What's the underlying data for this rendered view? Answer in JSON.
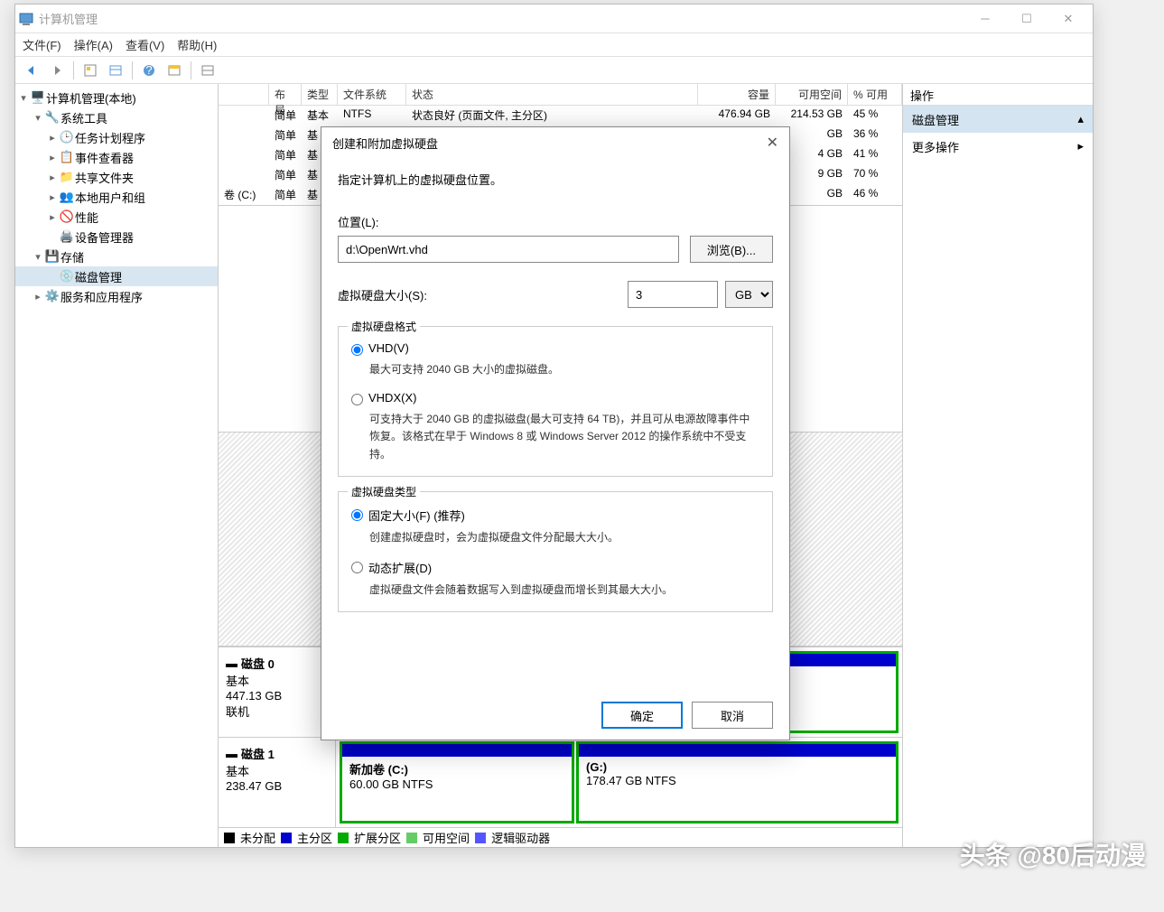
{
  "window": {
    "title": "计算机管理"
  },
  "menu": [
    "文件(F)",
    "操作(A)",
    "查看(V)",
    "帮助(H)"
  ],
  "tree": {
    "root": "计算机管理(本地)",
    "system_tools": "系统工具",
    "items": [
      "任务计划程序",
      "事件查看器",
      "共享文件夹",
      "本地用户和组",
      "性能",
      "设备管理器"
    ],
    "storage": "存储",
    "disk_mgmt": "磁盘管理",
    "services": "服务和应用程序"
  },
  "table": {
    "headers": [
      "",
      "布局",
      "类型",
      "文件系统",
      "状态",
      "容量",
      "可用空间",
      "% 可用"
    ],
    "rows": [
      {
        "vol": "",
        "layout": "简单",
        "type": "基本",
        "fs": "NTFS",
        "status": "状态良好 (页面文件, 主分区)",
        "cap": "476.94 GB",
        "free": "214.53 GB",
        "pct": "45 %"
      },
      {
        "vol": "",
        "layout": "简单",
        "type": "基",
        "fs": "",
        "status": "",
        "cap": "",
        "free": "GB",
        "pct": "36 %"
      },
      {
        "vol": "",
        "layout": "简单",
        "type": "基",
        "fs": "",
        "status": "",
        "cap": "",
        "free": "4 GB",
        "pct": "41 %"
      },
      {
        "vol": "",
        "layout": "简单",
        "type": "基",
        "fs": "",
        "status": "",
        "cap": "",
        "free": "9 GB",
        "pct": "70 %"
      },
      {
        "vol": "卷 (C:)",
        "layout": "简单",
        "type": "基",
        "fs": "",
        "status": "",
        "cap": "",
        "free": "GB",
        "pct": "46 %"
      }
    ]
  },
  "disks": [
    {
      "name": "磁盘 0",
      "type": "基本",
      "size": "447.13 GB",
      "status": "联机",
      "parts": []
    },
    {
      "name": "磁盘 1",
      "type": "基本",
      "size": "238.47 GB",
      "status": "",
      "parts": [
        {
          "name": "新加卷  (C:)",
          "info": "60.00 GB NTFS"
        },
        {
          "name": "(G:)",
          "info": "178.47 GB NTFS"
        }
      ]
    }
  ],
  "legend": [
    "未分配",
    "主分区",
    "扩展分区",
    "可用空间",
    "逻辑驱动器"
  ],
  "actions": {
    "title": "操作",
    "disk_mgmt": "磁盘管理",
    "more": "更多操作"
  },
  "dialog": {
    "title": "创建和附加虚拟硬盘",
    "instr": "指定计算机上的虚拟硬盘位置。",
    "loc_label": "位置(L):",
    "loc_value": "d:\\OpenWrt.vhd",
    "browse": "浏览(B)...",
    "size_label": "虚拟硬盘大小(S):",
    "size_value": "3",
    "size_unit": "GB",
    "format_group": "虚拟硬盘格式",
    "vhd": "VHD(V)",
    "vhd_desc": "最大可支持 2040 GB 大小的虚拟磁盘。",
    "vhdx": "VHDX(X)",
    "vhdx_desc": "可支持大于 2040 GB 的虚拟磁盘(最大可支持 64 TB)，并且可从电源故障事件中恢复。该格式在早于 Windows 8 或 Windows Server 2012 的操作系统中不受支持。",
    "type_group": "虚拟硬盘类型",
    "fixed": "固定大小(F) (推荐)",
    "fixed_desc": "创建虚拟硬盘时，会为虚拟硬盘文件分配最大大小。",
    "dynamic": "动态扩展(D)",
    "dynamic_desc": "虚拟硬盘文件会随着数据写入到虚拟硬盘而增长到其最大大小。",
    "ok": "确定",
    "cancel": "取消"
  },
  "watermark": "头条 @80后动漫"
}
